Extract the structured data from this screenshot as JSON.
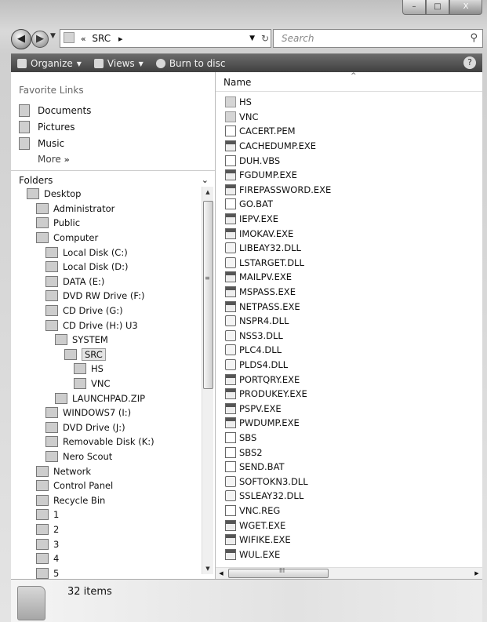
{
  "window": {
    "controls": {
      "minimize": "–",
      "maximize": "□",
      "close": "X"
    }
  },
  "address": {
    "back_glyph": "◀",
    "forward_glyph": "▶",
    "prefix": "«",
    "crumb": "SRC",
    "crumb_chevron": "▸",
    "refresh_glyph": "⁴⁄₊"
  },
  "search": {
    "placeholder": "Search"
  },
  "toolbar": {
    "organize": "Organize",
    "views": "Views",
    "burn": "Burn to disc",
    "help": "?"
  },
  "nav": {
    "favorites_title": "Favorite Links",
    "favorites": [
      {
        "label": "Documents",
        "icon": "documents-icon"
      },
      {
        "label": "Pictures",
        "icon": "pictures-icon"
      },
      {
        "label": "Music",
        "icon": "music-icon"
      }
    ],
    "more": "More",
    "more_arrows": "»",
    "folders_title": "Folders",
    "tree": [
      {
        "label": "Desktop",
        "indent": 0
      },
      {
        "label": "Administrator",
        "indent": 1
      },
      {
        "label": "Public",
        "indent": 1
      },
      {
        "label": "Computer",
        "indent": 1
      },
      {
        "label": "Local Disk (C:)",
        "indent": 2
      },
      {
        "label": "Local Disk (D:)",
        "indent": 2
      },
      {
        "label": "DATA (E:)",
        "indent": 2
      },
      {
        "label": "DVD RW Drive (F:)",
        "indent": 2
      },
      {
        "label": "CD Drive (G:)",
        "indent": 2
      },
      {
        "label": "CD Drive (H:) U3",
        "indent": 2
      },
      {
        "label": "SYSTEM",
        "indent": 3
      },
      {
        "label": "SRC",
        "indent": 4,
        "selected": true
      },
      {
        "label": "HS",
        "indent": 5
      },
      {
        "label": "VNC",
        "indent": 5
      },
      {
        "label": "LAUNCHPAD.ZIP",
        "indent": 3
      },
      {
        "label": "WINDOWS7 (I:)",
        "indent": 2
      },
      {
        "label": "DVD Drive (J:)",
        "indent": 2
      },
      {
        "label": "Removable Disk (K:)",
        "indent": 2
      },
      {
        "label": "Nero Scout",
        "indent": 2
      },
      {
        "label": "Network",
        "indent": 1
      },
      {
        "label": "Control Panel",
        "indent": 1
      },
      {
        "label": "Recycle Bin",
        "indent": 1
      },
      {
        "label": "1",
        "indent": 1
      },
      {
        "label": "2",
        "indent": 1
      },
      {
        "label": "3",
        "indent": 1
      },
      {
        "label": "4",
        "indent": 1
      },
      {
        "label": "5",
        "indent": 1
      }
    ]
  },
  "list": {
    "column": "Name",
    "sort_glyph": "^",
    "files": [
      {
        "name": "HS",
        "type": "folder"
      },
      {
        "name": "VNC",
        "type": "folder"
      },
      {
        "name": "CACERT.PEM",
        "type": "doc"
      },
      {
        "name": "CACHEDUMP.EXE",
        "type": "exe"
      },
      {
        "name": "DUH.VBS",
        "type": "doc"
      },
      {
        "name": "FGDUMP.EXE",
        "type": "exe"
      },
      {
        "name": "FIREPASSWORD.EXE",
        "type": "exe"
      },
      {
        "name": "GO.BAT",
        "type": "doc"
      },
      {
        "name": "IEPV.EXE",
        "type": "exe"
      },
      {
        "name": "IMOKAV.EXE",
        "type": "exe"
      },
      {
        "name": "LIBEAY32.DLL",
        "type": "dll"
      },
      {
        "name": "LSTARGET.DLL",
        "type": "dll"
      },
      {
        "name": "MAILPV.EXE",
        "type": "exe"
      },
      {
        "name": "MSPASS.EXE",
        "type": "exe"
      },
      {
        "name": "NETPASS.EXE",
        "type": "exe"
      },
      {
        "name": "NSPR4.DLL",
        "type": "dll"
      },
      {
        "name": "NSS3.DLL",
        "type": "dll"
      },
      {
        "name": "PLC4.DLL",
        "type": "dll"
      },
      {
        "name": "PLDS4.DLL",
        "type": "dll"
      },
      {
        "name": "PORTQRY.EXE",
        "type": "exe"
      },
      {
        "name": "PRODUKEY.EXE",
        "type": "exe"
      },
      {
        "name": "PSPV.EXE",
        "type": "exe"
      },
      {
        "name": "PWDUMP.EXE",
        "type": "exe"
      },
      {
        "name": "SBS",
        "type": "doc"
      },
      {
        "name": "SBS2",
        "type": "doc"
      },
      {
        "name": "SEND.BAT",
        "type": "doc"
      },
      {
        "name": "SOFTOKN3.DLL",
        "type": "dll"
      },
      {
        "name": "SSLEAY32.DLL",
        "type": "dll"
      },
      {
        "name": "VNC.REG",
        "type": "doc"
      },
      {
        "name": "WGET.EXE",
        "type": "exe"
      },
      {
        "name": "WIFIKE.EXE",
        "type": "exe"
      },
      {
        "name": "WUL.EXE",
        "type": "exe"
      }
    ]
  },
  "scroll": {
    "up": "▲",
    "down": "▼",
    "left": "◀",
    "right": "▶",
    "grip_v": "≡",
    "grip_h": "III"
  },
  "status": {
    "count": "32 items"
  }
}
